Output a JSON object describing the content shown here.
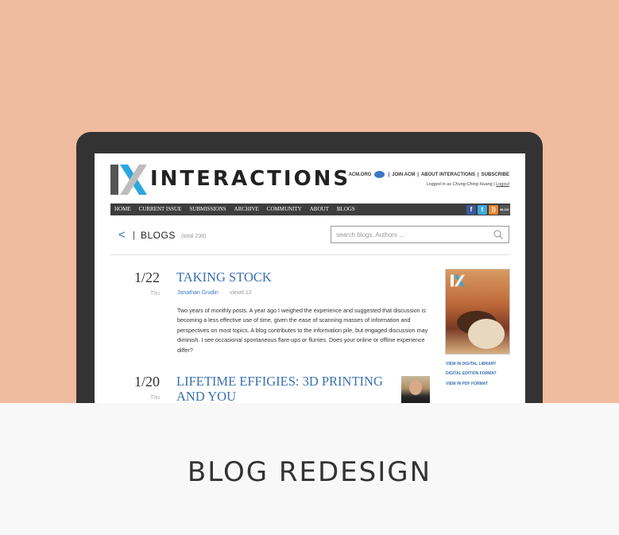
{
  "site": {
    "logo_text": "INTERACTIONS",
    "top_links": [
      "ACM.ORG",
      "JOIN ACM",
      "ABOUT INTERACTIONS",
      "SUBSCRIBE"
    ],
    "logged_in_prefix": "Logged in as ",
    "logged_in_user": "Chung-Ching Huang",
    "logout_label": "Logout"
  },
  "nav": {
    "items": [
      "HOME",
      "CURRENT ISSUE",
      "SUBMISSIONS",
      "ARCHIVE",
      "COMMUNITY",
      "ABOUT",
      "BLOGS"
    ],
    "social_icons": [
      "facebook-icon",
      "twitter-icon",
      "rss-icon",
      "blog-icon"
    ]
  },
  "blogs_header": {
    "back_symbol": "<",
    "separator": "|",
    "title": "BLOGS",
    "total": "(total 238)"
  },
  "search": {
    "placeholder": "search blogs, Authors ..."
  },
  "posts": [
    {
      "date": "1/22",
      "day": "Thu",
      "title": "TAKING STOCK",
      "author": "Jonathan Grudin",
      "views": "viewd 12",
      "excerpt": "Two years of monthly posts. A year ago I weighed the experience and suggested that discussion is becoming a less effective use of time, given the ease of scanning masses of information and perspectives on most topics. A blog contributes to the information pile, but engaged discussion may diminish. I see occasional spontaneous flare-ups or flurries. Does your online or offline experience differ?"
    },
    {
      "date": "1/20",
      "day": "Thu",
      "title_line1": "LIFETIME EFFIGIES: 3D PRINTING",
      "title_line2": "AND YOU"
    }
  ],
  "sidebar": {
    "links": [
      "VIEW IN DIGITAL LIBRARY",
      "DIGITAL EDITION FORMAT",
      "VIEW IN PDF FORMAT"
    ]
  },
  "caption": "BLOG REDESIGN",
  "colors": {
    "background_top": "#efbc9f",
    "background_bottom": "#f9f8f8",
    "device_frame": "#333333",
    "link_blue": "#3a78c2",
    "nav_bar": "#3d3d3d"
  }
}
